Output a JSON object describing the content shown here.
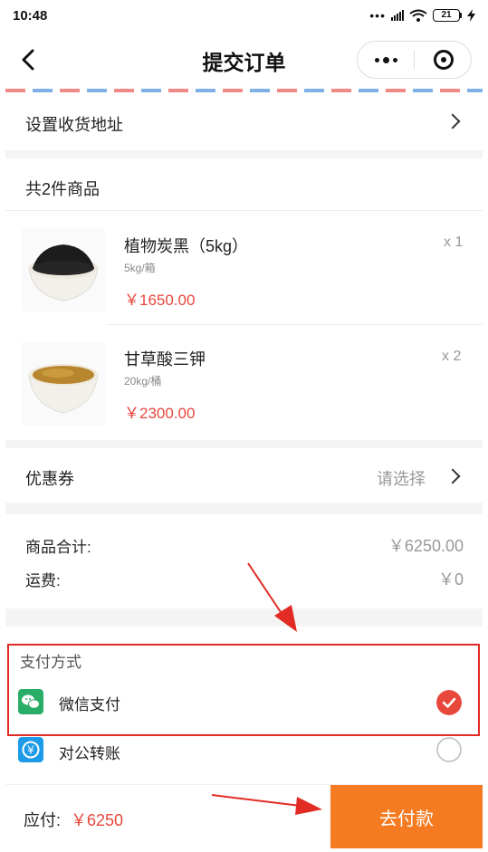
{
  "status_bar": {
    "time": "10:48",
    "signal_dots": "•••",
    "battery_level": "21",
    "icons": [
      "signal-icon",
      "wifi-icon",
      "battery-icon",
      "charging-icon"
    ]
  },
  "nav": {
    "title": "提交订单",
    "back_icon": "back-arrow-icon",
    "menu_icon": "more-dots-icon",
    "close_icon": "miniprogram-close-icon"
  },
  "address": {
    "label": "设置收货地址"
  },
  "goods": {
    "header": "共2件商品",
    "items": [
      {
        "name": "植物炭黑（5kg）",
        "spec": "5kg/箱",
        "price": "￥1650.00",
        "qty": "x 1",
        "image": "black-powder-bowl"
      },
      {
        "name": "甘草酸三钾",
        "spec": "20kg/桶",
        "price": "￥2300.00",
        "qty": "x 2",
        "image": "yellow-powder-bowl"
      }
    ]
  },
  "coupon": {
    "label": "优惠券",
    "value": "请选择"
  },
  "summary": {
    "goods_total_label": "商品合计:",
    "goods_total_value": "￥6250.00",
    "freight_label": "运费:",
    "freight_value": "￥0"
  },
  "payment": {
    "title": "支付方式",
    "options": [
      {
        "label": "微信支付",
        "icon": "wechat-icon",
        "selected": true
      },
      {
        "label": "对公转账",
        "icon": "transfer-icon",
        "selected": false
      }
    ]
  },
  "footer": {
    "due_label": "应付:",
    "due_value": "￥6250",
    "pay_button": "去付款"
  },
  "colors": {
    "accent_price": "#e8473c",
    "pay_button": "#f47b21",
    "annotation": "#e32b25",
    "wechat": "#2aae67",
    "transfer": "#1e9be8"
  }
}
